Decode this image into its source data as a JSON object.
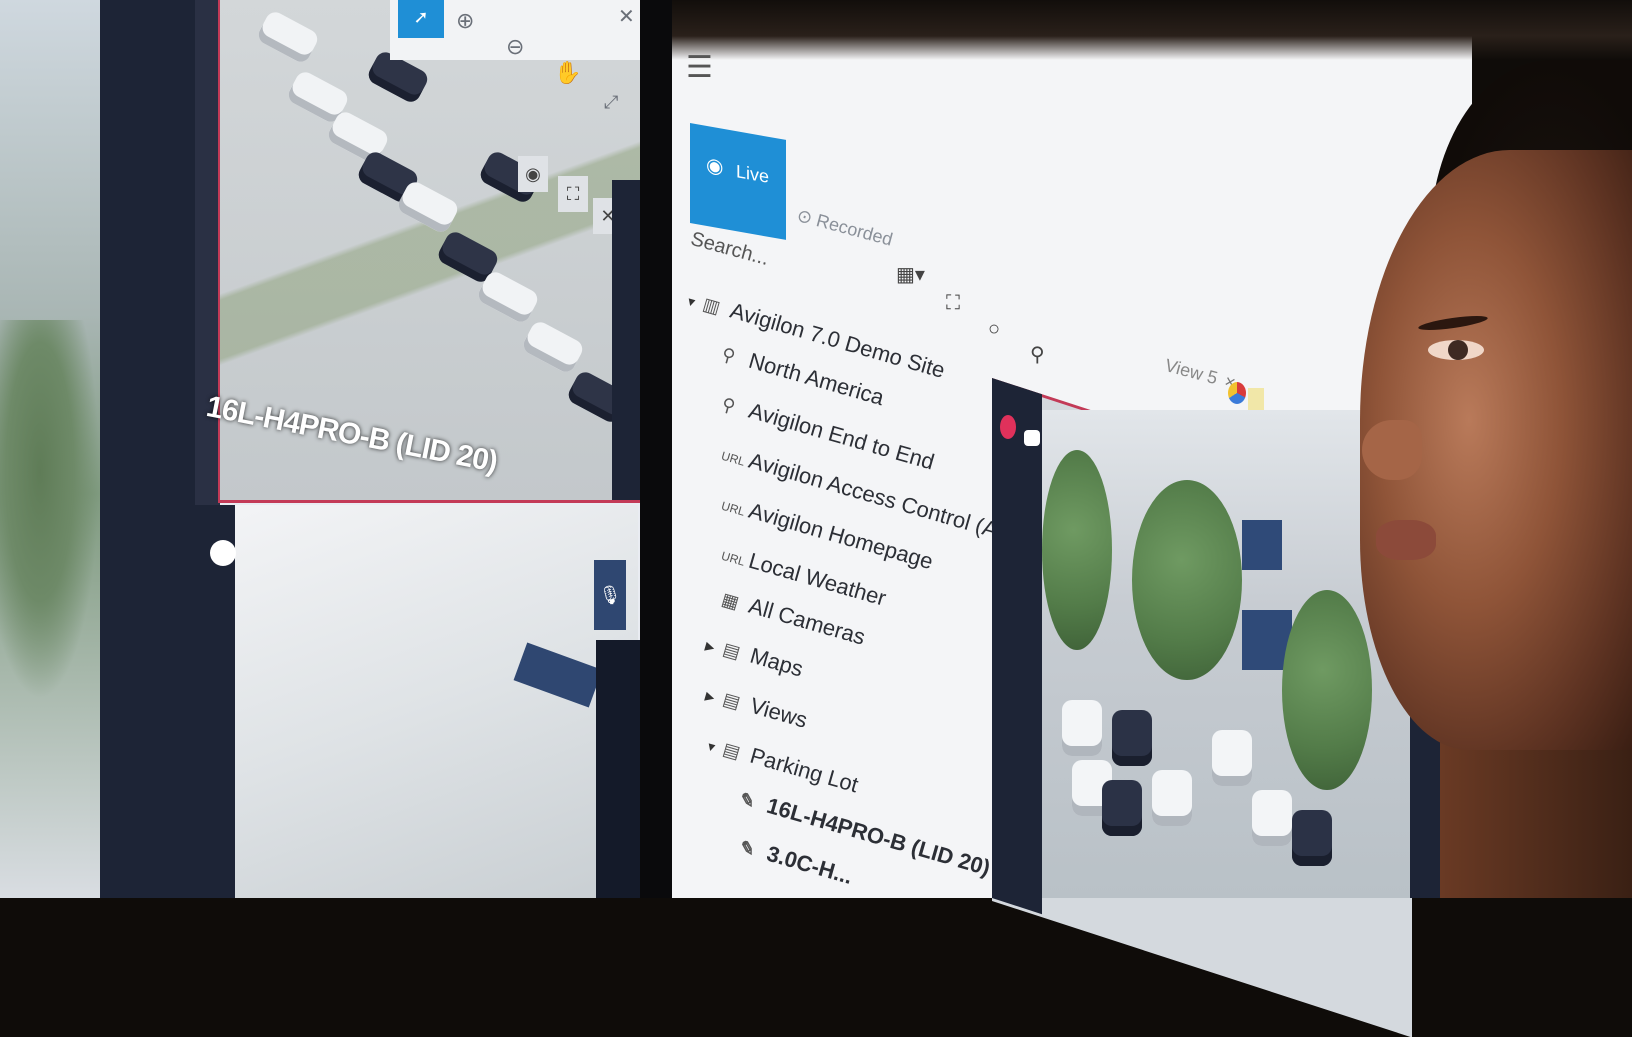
{
  "left_monitor": {
    "top_camera_label": "16L-H4PRO-B (LID 20)",
    "toolbar": [
      "select-icon",
      "zoom-in-icon",
      "zoom-out-icon",
      "pan-hand-icon",
      "fullscreen-icon",
      "close-icon"
    ],
    "camera_controls": [
      "snapshot-icon",
      "expand-icon",
      "close-icon"
    ]
  },
  "client": {
    "tabs": [
      {
        "label": "Live",
        "active": true
      },
      {
        "label": "Recorded",
        "active": false
      }
    ],
    "search": {
      "placeholder": "Search..."
    },
    "tree": [
      {
        "label": "Avigilon 7.0 Demo Site",
        "icon": "site-icon",
        "expanded": true
      },
      {
        "label": "North America",
        "icon": "location-pin-icon"
      },
      {
        "label": "Avigilon End to End",
        "icon": "location-pin-icon"
      },
      {
        "label": "Avigilon Access Control (ACM)",
        "icon": "url-icon"
      },
      {
        "label": "Avigilon Homepage",
        "icon": "url-icon"
      },
      {
        "label": "Local Weather",
        "icon": "url-icon"
      },
      {
        "label": "All Cameras",
        "icon": "grid-icon"
      },
      {
        "label": "Maps",
        "icon": "folder-icon",
        "expanded": false
      },
      {
        "label": "Views",
        "icon": "folder-icon",
        "expanded": false
      },
      {
        "label": "Parking Lot",
        "icon": "folder-icon",
        "expanded": true
      },
      {
        "label": "16L-H4PRO-B (LID 20)",
        "icon": "camera-icon"
      },
      {
        "label": "3.0C-H...",
        "icon": "camera-icon"
      }
    ],
    "view_tab": {
      "label": "View 5",
      "close": "×"
    }
  },
  "colors": {
    "accent_blue": "#1f8fd6",
    "navy": "#1d2436",
    "highlight_red": "#c33a57"
  }
}
